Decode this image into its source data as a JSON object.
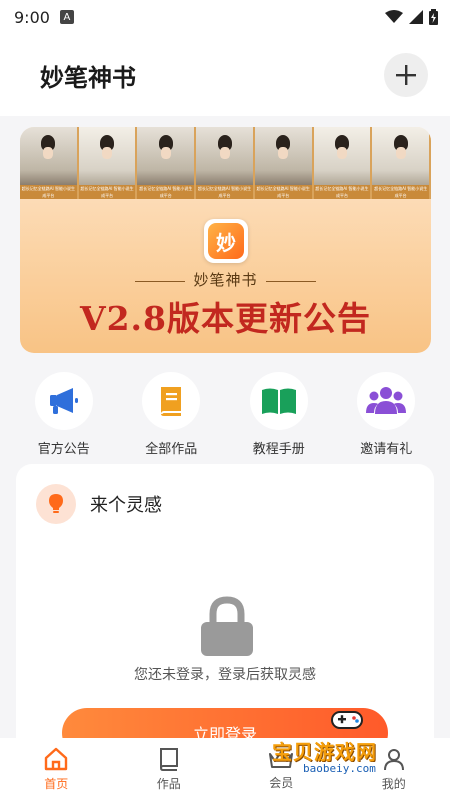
{
  "status_bar": {
    "time": "9:00",
    "a_glyph": "A"
  },
  "header": {
    "title": "妙笔神书",
    "add_icon": "plus-icon"
  },
  "banner": {
    "portrait_caption": "超长记忆全链路AI 智能小说生成平台",
    "logo_glyph": "妙",
    "brand": "妙笔神书",
    "headline": "V2.8版本更新公告"
  },
  "quick_actions": [
    {
      "label": "官方公告",
      "icon": "megaphone-icon",
      "color": "#2f6fdb"
    },
    {
      "label": "全部作品",
      "icon": "book-icon",
      "color": "#f0a020"
    },
    {
      "label": "教程手册",
      "icon": "open-book-icon",
      "color": "#19a05a"
    },
    {
      "label": "邀请有礼",
      "icon": "users-icon",
      "color": "#8a4fd6"
    }
  ],
  "inspiration": {
    "title": "来个灵感",
    "empty_text": "您还未登录，登录后获取灵感",
    "login_label": "立即登录"
  },
  "tabs": [
    {
      "label": "首页",
      "icon": "home-icon",
      "active": true
    },
    {
      "label": "作品",
      "icon": "book-icon",
      "active": false
    },
    {
      "label": "会员",
      "icon": "crown-icon",
      "active": false
    },
    {
      "label": "我的",
      "icon": "user-icon",
      "active": false
    }
  ],
  "watermark": {
    "text": "宝贝游戏网",
    "url": "baobeiy.com"
  },
  "colors": {
    "accent": "#ff6a1a",
    "headline_red": "#c2281f"
  }
}
